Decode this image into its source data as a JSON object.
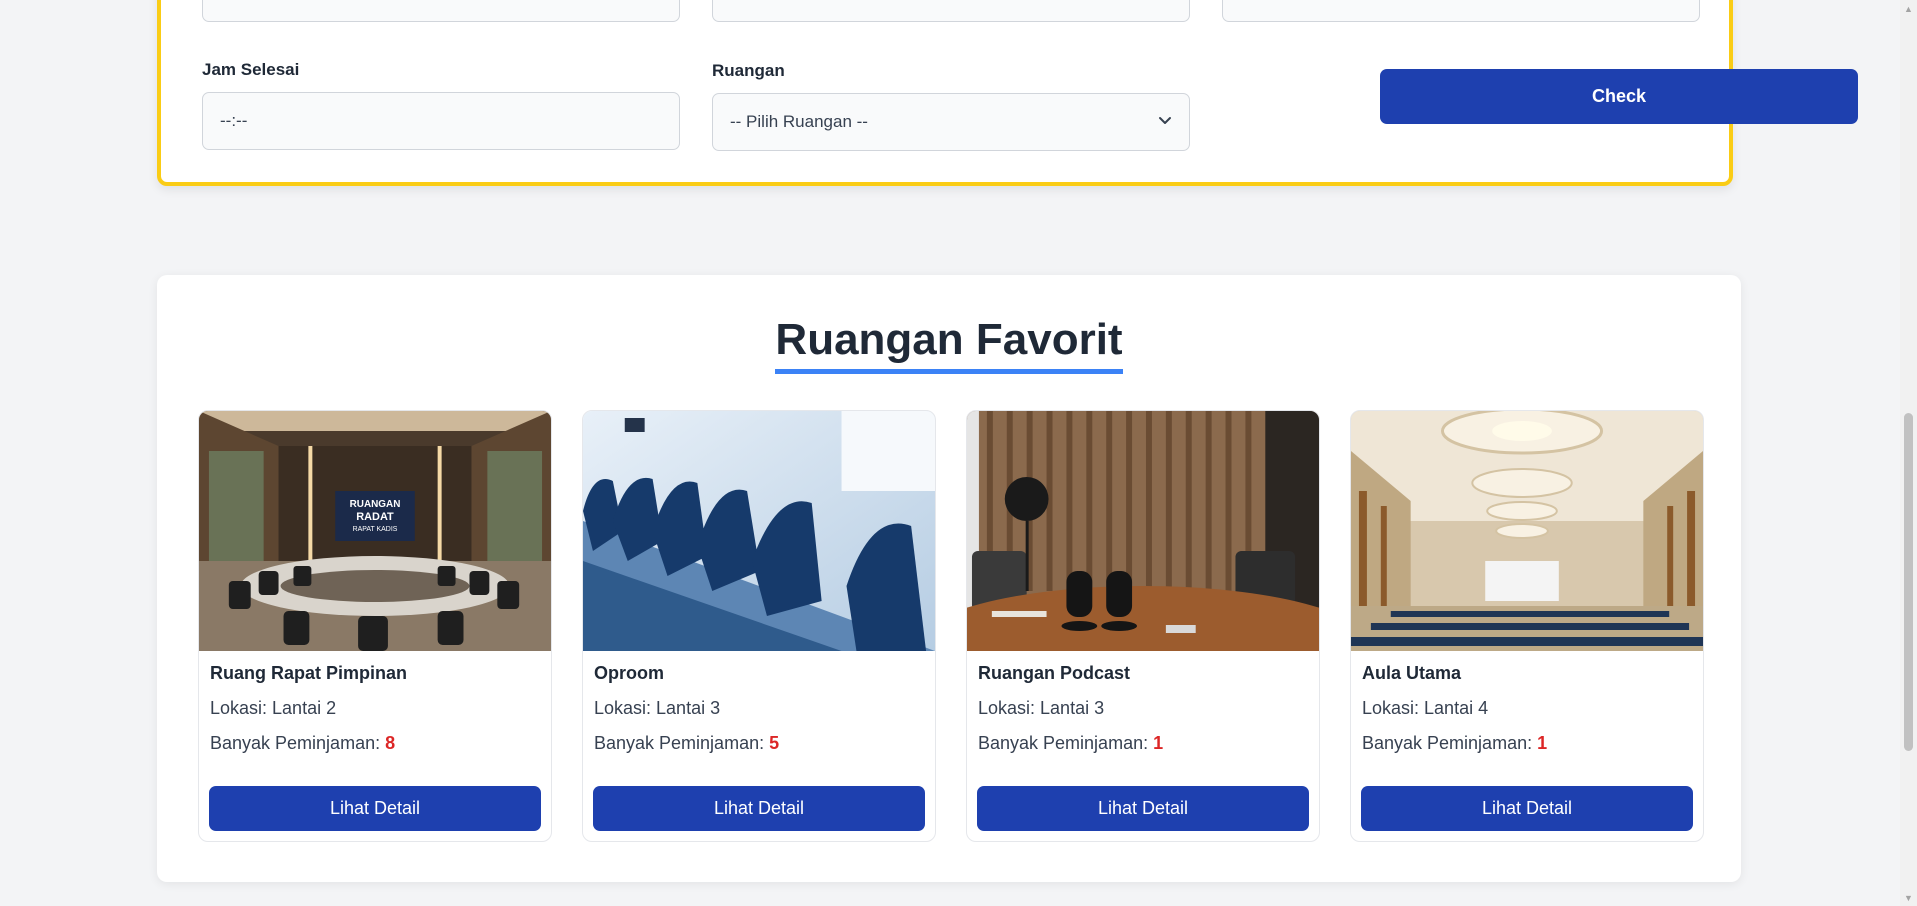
{
  "form": {
    "end_time": {
      "label": "Jam Selesai",
      "value": "--:--"
    },
    "room": {
      "label": "Ruangan",
      "selected": "-- Pilih Ruangan --"
    },
    "top_partial_value": "·",
    "check_label": "Check"
  },
  "favorites": {
    "title": "Ruangan Favorit",
    "count_label": "Banyak Peminjaman:",
    "button_label": "Lihat Detail",
    "rooms": [
      {
        "name": "Ruang Rapat Pimpinan",
        "location": "Lokasi: Lantai 2",
        "count": "8",
        "image_text": [
          "RUANGAN",
          "RADAT",
          "RAPAT KADIS"
        ]
      },
      {
        "name": "Oproom",
        "location": "Lokasi: Lantai 3",
        "count": "5"
      },
      {
        "name": "Ruangan Podcast",
        "location": "Lokasi: Lantai 3",
        "count": "1"
      },
      {
        "name": "Aula Utama",
        "location": "Lokasi: Lantai 4",
        "count": "1"
      }
    ]
  },
  "colors": {
    "accent": "#1e40af",
    "border_highlight": "#facc15",
    "count": "#dc2626",
    "underline": "#3b82f6"
  },
  "icons": {
    "select": "chevron-down-icon",
    "scroll_up": "scroll-up-icon",
    "scroll_down": "scroll-down-icon"
  }
}
